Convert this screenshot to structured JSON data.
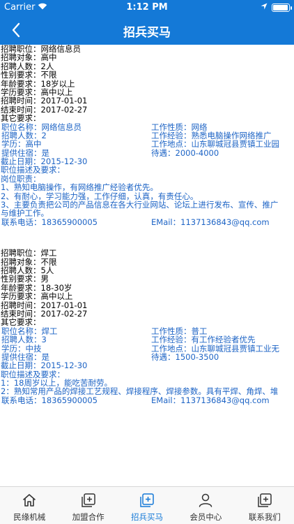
{
  "status": {
    "carrier": "Carrier",
    "time": "1:12 PM",
    "battery_level": 0.95
  },
  "nav": {
    "title": "招兵买马"
  },
  "jobs": [
    {
      "header": [
        "招聘职位：网络信息员",
        "招聘对象：高中",
        "招聘人数：2人",
        "性别要求：不限",
        "年龄要求：18岁以上",
        "学历要求：高中以上",
        "招聘时间：2017-01-01",
        "结束时间：2017-02-27",
        "其它要求："
      ],
      "details": [
        {
          "left": "职位名称：网络信息员",
          "right": "工作性质：网络"
        },
        {
          "left": "招聘人数：2",
          "right": "工作经验：熟悉电脑操作网络推广"
        },
        {
          "left": "学历：高中",
          "right": "工作地点：山东聊城冠县贾镇工业园"
        },
        {
          "left": "提供住宿：是",
          "right": "待遇：2000-4000"
        }
      ],
      "deadline": "截止日期：2015-12-30",
      "desc_label": "职位描述及要求：",
      "duty_label": "岗位职责：",
      "duties": [
        "1、熟知电脑操作，有网络推广经验者优先。",
        "2、有耐心，学习能力强，工作仔细，认真，有责任心。",
        "3、主要负责把公司的产品信息在各大行业网站、论坛上进行发布、宣传、推广",
        "与维护工作。"
      ],
      "contact": {
        "phone": "联系电话：18365900005",
        "email": "EMail：1137136843@qq.com"
      }
    },
    {
      "header": [
        "招聘职位：焊工",
        "招聘对象：不限",
        "招聘人数：5人",
        "性别要求：男",
        "年龄要求：18-30岁",
        "学历要求：高中以上",
        "招聘时间：2017-01-01",
        "结束时间：2017-02-27",
        "其它要求："
      ],
      "details": [
        {
          "left": "职位名称：焊工",
          "right": "工作性质：普工"
        },
        {
          "left": "招聘人数：3",
          "right": "工作经验：有工作经验者优先"
        },
        {
          "left": "学历：中技",
          "right": "工作地点：山东聊城冠县贾镇工业无"
        },
        {
          "left": "提供住宿：是",
          "right": "待遇：1500-3500"
        }
      ],
      "deadline": "截止日期：2015-12-30",
      "desc_label": "职位描述及要求：",
      "duties": [
        "1：18周岁以上，能吃苦耐劳。",
        "2：熟知常用产品的焊接工艺规程、焊接程序、焊接参数。具有平焊、角焊、堆"
      ],
      "contact": {
        "phone": "联系电话：18365900005",
        "email": "EMail：1137136843@qq.com"
      }
    }
  ],
  "tabs": [
    {
      "label": "民缘机械",
      "icon": "home-icon"
    },
    {
      "label": "加盟合作",
      "icon": "plus-square-icon"
    },
    {
      "label": "招兵买马",
      "icon": "plus-square-icon"
    },
    {
      "label": "会员中心",
      "icon": "person-icon"
    },
    {
      "label": "联系我们",
      "icon": "plus-square-icon"
    }
  ],
  "colors": {
    "accent": "#1479d7",
    "link_blue": "#1c63c5",
    "tab_inactive": "#333333"
  }
}
